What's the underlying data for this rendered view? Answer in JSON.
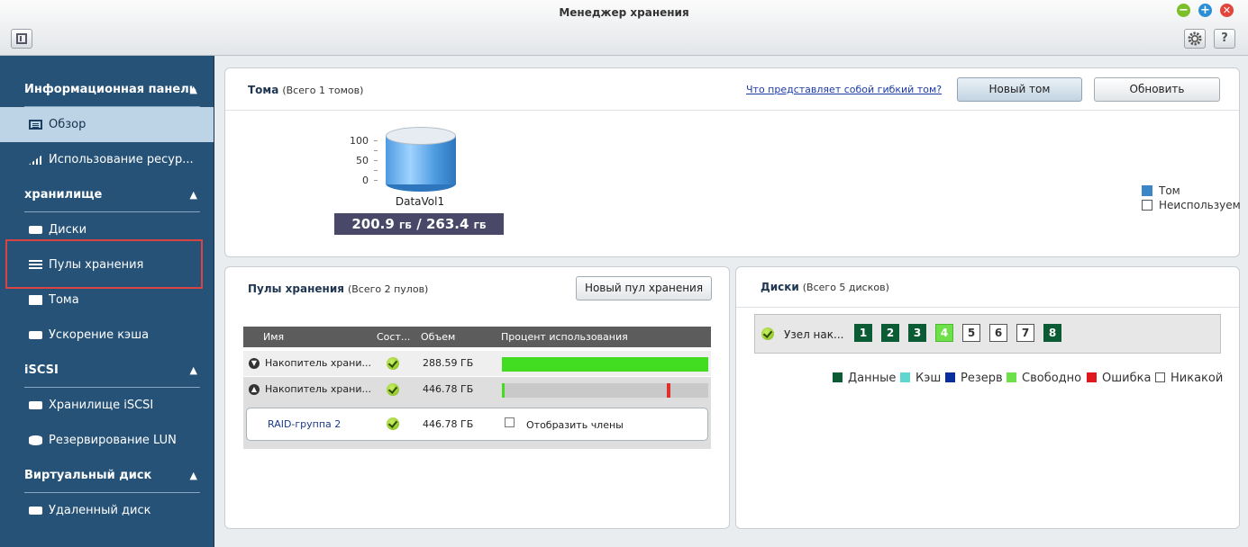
{
  "window": {
    "title": "Менеджер хранения"
  },
  "sidebar": {
    "sections": [
      {
        "label": "Информационная панель",
        "items": [
          "Обзор",
          "Использование ресур..."
        ]
      },
      {
        "label": "хранилище",
        "items": [
          "Диски",
          "Пулы хранения",
          "Тома",
          "Ускорение кэша"
        ]
      },
      {
        "label": "iSCSI",
        "items": [
          "Хранилище iSCSI",
          "Резервирование LUN"
        ]
      },
      {
        "label": "Виртуальный диск",
        "items": [
          "Удаленный диск"
        ]
      }
    ],
    "active_item": "Обзор"
  },
  "volumes": {
    "title": "Тома",
    "subtitle": "(Всего 1 томов)",
    "help_link": "Что представляет собой гибкий том?",
    "new_button": "Новый том",
    "refresh_button": "Обновить",
    "axis": [
      "100",
      "50",
      "0"
    ],
    "volume_name": "DataVol1",
    "used": "200.9",
    "used_unit": "ГБ",
    "separator": "/",
    "total": "263.4",
    "total_unit": "ГБ",
    "used_fraction": 0.763,
    "legend": [
      {
        "label": "Том",
        "color": "#3a86c8"
      },
      {
        "label": "Неиспользуем",
        "color": "#ffffff"
      }
    ]
  },
  "pools": {
    "title": "Пулы хранения",
    "subtitle": "(Всего 2 пулов)",
    "new_button": "Новый пул хранения",
    "columns": [
      "Имя",
      "Сост...",
      "Объем",
      "Процент использования"
    ],
    "rows": [
      {
        "name": "Накопитель храни...",
        "size": "288.59 ГБ",
        "usage_fraction": 1.0,
        "expanded": false
      },
      {
        "name": "Накопитель храни...",
        "size": "446.78 ГБ",
        "usage_fraction": 0.01,
        "threshold_fraction": 0.8,
        "expanded": true
      }
    ],
    "raid": {
      "name": "RAID-группа 2",
      "size": "446.78 ГБ",
      "show_members": "Отобразить члены"
    }
  },
  "disks": {
    "title": "Диски",
    "subtitle": "(Всего 5 дисков)",
    "node_label": "Узел нак...",
    "slots": [
      {
        "n": "1",
        "state": "data"
      },
      {
        "n": "2",
        "state": "data"
      },
      {
        "n": "3",
        "state": "data"
      },
      {
        "n": "4",
        "state": "free"
      },
      {
        "n": "5",
        "state": "none"
      },
      {
        "n": "6",
        "state": "none"
      },
      {
        "n": "7",
        "state": "none"
      },
      {
        "n": "8",
        "state": "data"
      }
    ],
    "legend": [
      {
        "label": "Данные",
        "color": "#0b5b34"
      },
      {
        "label": "Кэш",
        "color": "#5fd6d0"
      },
      {
        "label": "Резерв",
        "color": "#0a2f9c"
      },
      {
        "label": "Свободно",
        "color": "#6ee04a"
      },
      {
        "label": "Ошибка",
        "color": "#e0181e"
      },
      {
        "label": "Никакой",
        "color": "#ffffff"
      }
    ]
  }
}
